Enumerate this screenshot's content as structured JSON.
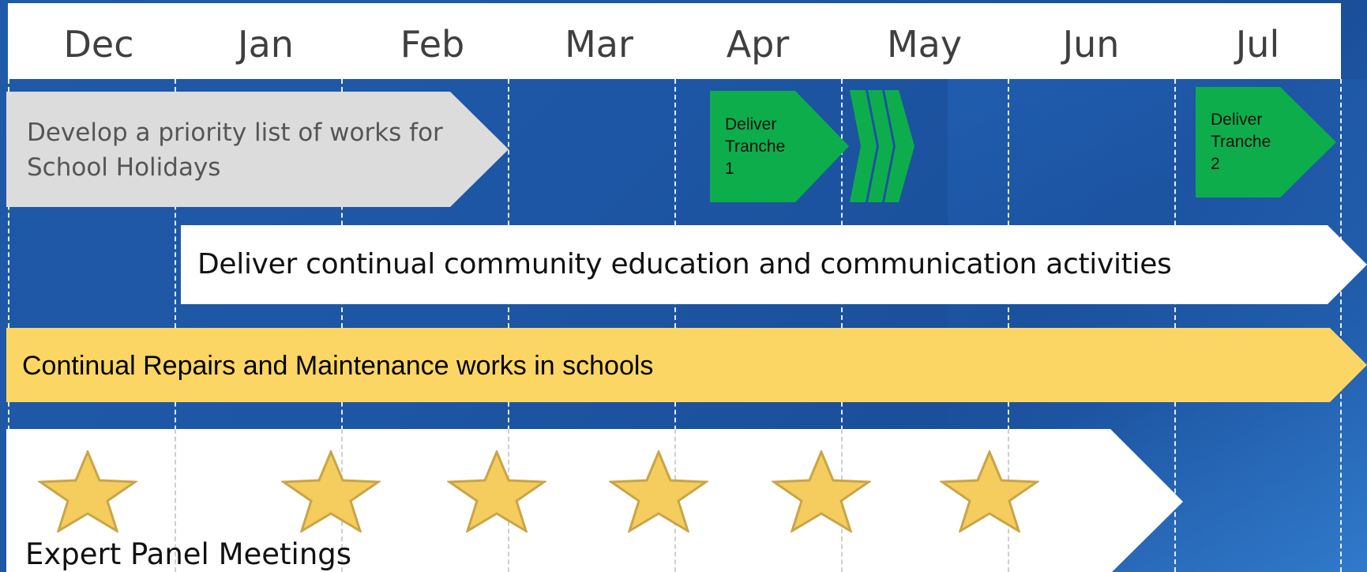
{
  "months": [
    "Dec",
    "Jan",
    "Feb",
    "Mar",
    "Apr",
    "May",
    "Jun",
    "Jul"
  ],
  "tasks": {
    "priority_list": {
      "label": "Develop a priority list of works for School Holidays",
      "color": "#dcdcdc"
    },
    "tranche1": {
      "label_lines": [
        "Deliver",
        "Tranche",
        "1"
      ],
      "color": "#0ead4b"
    },
    "tranche2": {
      "label_lines": [
        "Deliver",
        "Tranche",
        "2"
      ],
      "color": "#0ead4b"
    },
    "communication": {
      "label": "Deliver continual community education and communication activities",
      "color": "#ffffff"
    },
    "repairs": {
      "label": "Continual Repairs and Maintenance works in schools",
      "color": "#fbd665"
    },
    "expert_panel": {
      "label": "Expert Panel Meetings",
      "color": "#ffffff",
      "star_count": 6,
      "star_color": "#f5cd5e"
    }
  },
  "colors": {
    "background": "#1d56a4",
    "header": "#ffffff",
    "month_text": "#3f3f3f",
    "gridline": "#e8eef6"
  }
}
